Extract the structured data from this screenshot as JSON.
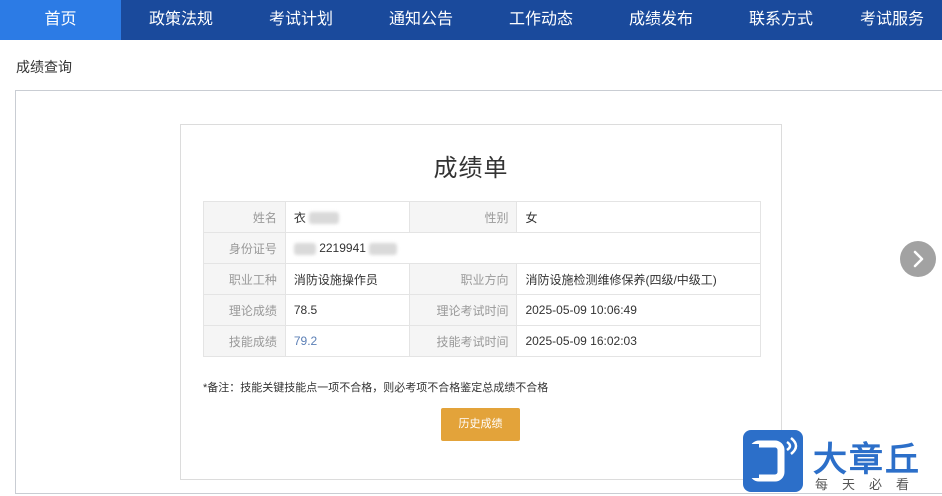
{
  "nav": {
    "items": [
      {
        "label": "首页",
        "active": true
      },
      {
        "label": "政策法规"
      },
      {
        "label": "考试计划"
      },
      {
        "label": "通知公告"
      },
      {
        "label": "工作动态"
      },
      {
        "label": "成绩发布"
      },
      {
        "label": "联系方式"
      },
      {
        "label": "考试服务"
      }
    ]
  },
  "page": {
    "title": "成绩查询"
  },
  "report": {
    "title": "成绩单",
    "rows": {
      "name_label": "姓名",
      "name_value": "衣",
      "gender_label": "性别",
      "gender_value": "女",
      "id_label": "身份证号",
      "id_value": "2219941",
      "job_label": "职业工种",
      "job_value": "消防设施操作员",
      "direction_label": "职业方向",
      "direction_value": "消防设施检测维修保养(四级/中级工)",
      "theory_label": "理论成绩",
      "theory_value": "78.5",
      "theory_time_label": "理论考试时间",
      "theory_time_value": "2025-05-09 10:06:49",
      "skill_label": "技能成绩",
      "skill_value": "79.2",
      "skill_time_label": "技能考试时间",
      "skill_time_value": "2025-05-09 16:02:03"
    },
    "note": "*备注：技能关键技能点一项不合格，则必考项不合格鉴定总成绩不合格",
    "history_button": "历史成绩"
  },
  "watermark": {
    "name": "大章丘",
    "slogan": "每天必看",
    "colors": {
      "brand": "#2c6fc9"
    }
  },
  "colors": {
    "nav_bg": "#1a4a9c",
    "nav_active": "#2c7be5",
    "button": "#e3a33a"
  }
}
